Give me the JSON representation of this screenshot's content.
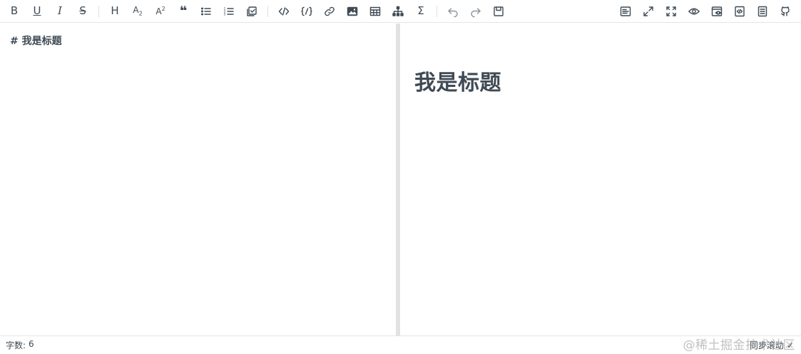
{
  "toolbar": {
    "left_buttons": [
      {
        "id": "bold",
        "icon": "bold-icon",
        "glyph": "B"
      },
      {
        "id": "underline",
        "icon": "underline-icon",
        "glyph": "U"
      },
      {
        "id": "italic",
        "icon": "italic-icon",
        "glyph": "I"
      },
      {
        "id": "strikethrough",
        "icon": "strikethrough-icon",
        "glyph": "S"
      },
      {
        "id": "heading",
        "icon": "heading-icon",
        "glyph": "H"
      },
      {
        "id": "subscript",
        "icon": "subscript-icon",
        "glyph": "A"
      },
      {
        "id": "superscript",
        "icon": "superscript-icon",
        "glyph": "A"
      },
      {
        "id": "quote",
        "icon": "quote-icon",
        "glyph": "❝"
      },
      {
        "id": "unordered-list",
        "icon": "unordered-list-icon"
      },
      {
        "id": "ordered-list",
        "icon": "ordered-list-icon"
      },
      {
        "id": "task",
        "icon": "task-icon"
      },
      {
        "id": "code-row",
        "icon": "code-icon",
        "glyph": "</>"
      },
      {
        "id": "code-block",
        "icon": "code-block-icon",
        "glyph": "{/}"
      },
      {
        "id": "link",
        "icon": "link-icon"
      },
      {
        "id": "image",
        "icon": "image-icon"
      },
      {
        "id": "table",
        "icon": "table-icon"
      },
      {
        "id": "mermaid",
        "icon": "diagram-icon"
      },
      {
        "id": "katex",
        "icon": "sigma-icon",
        "glyph": "Σ"
      },
      {
        "id": "revoke",
        "icon": "undo-icon"
      },
      {
        "id": "next",
        "icon": "redo-icon"
      },
      {
        "id": "save",
        "icon": "save-icon"
      }
    ],
    "right_buttons": [
      {
        "id": "prettier",
        "icon": "prettier-icon"
      },
      {
        "id": "page-fullscreen",
        "icon": "page-fullscreen-icon"
      },
      {
        "id": "fullscreen",
        "icon": "fullscreen-icon"
      },
      {
        "id": "preview",
        "icon": "eye-icon"
      },
      {
        "id": "preview-only",
        "icon": "preview-only-icon"
      },
      {
        "id": "html-preview",
        "icon": "html-preview-icon"
      },
      {
        "id": "catalog",
        "icon": "catalog-icon"
      },
      {
        "id": "github",
        "icon": "github-icon"
      }
    ]
  },
  "editor": {
    "content": "# 我是标题"
  },
  "preview": {
    "heading": "我是标题"
  },
  "status": {
    "word_count_label": "字数:",
    "word_count_value": "6",
    "sync_scroll_label": "同步滚动",
    "sync_scroll_checked": true
  },
  "watermark": "@稀土掘金技术社区",
  "colors": {
    "text": "#3f4a54",
    "divider": "#e2e2e2",
    "border": "#e6e6e6"
  }
}
